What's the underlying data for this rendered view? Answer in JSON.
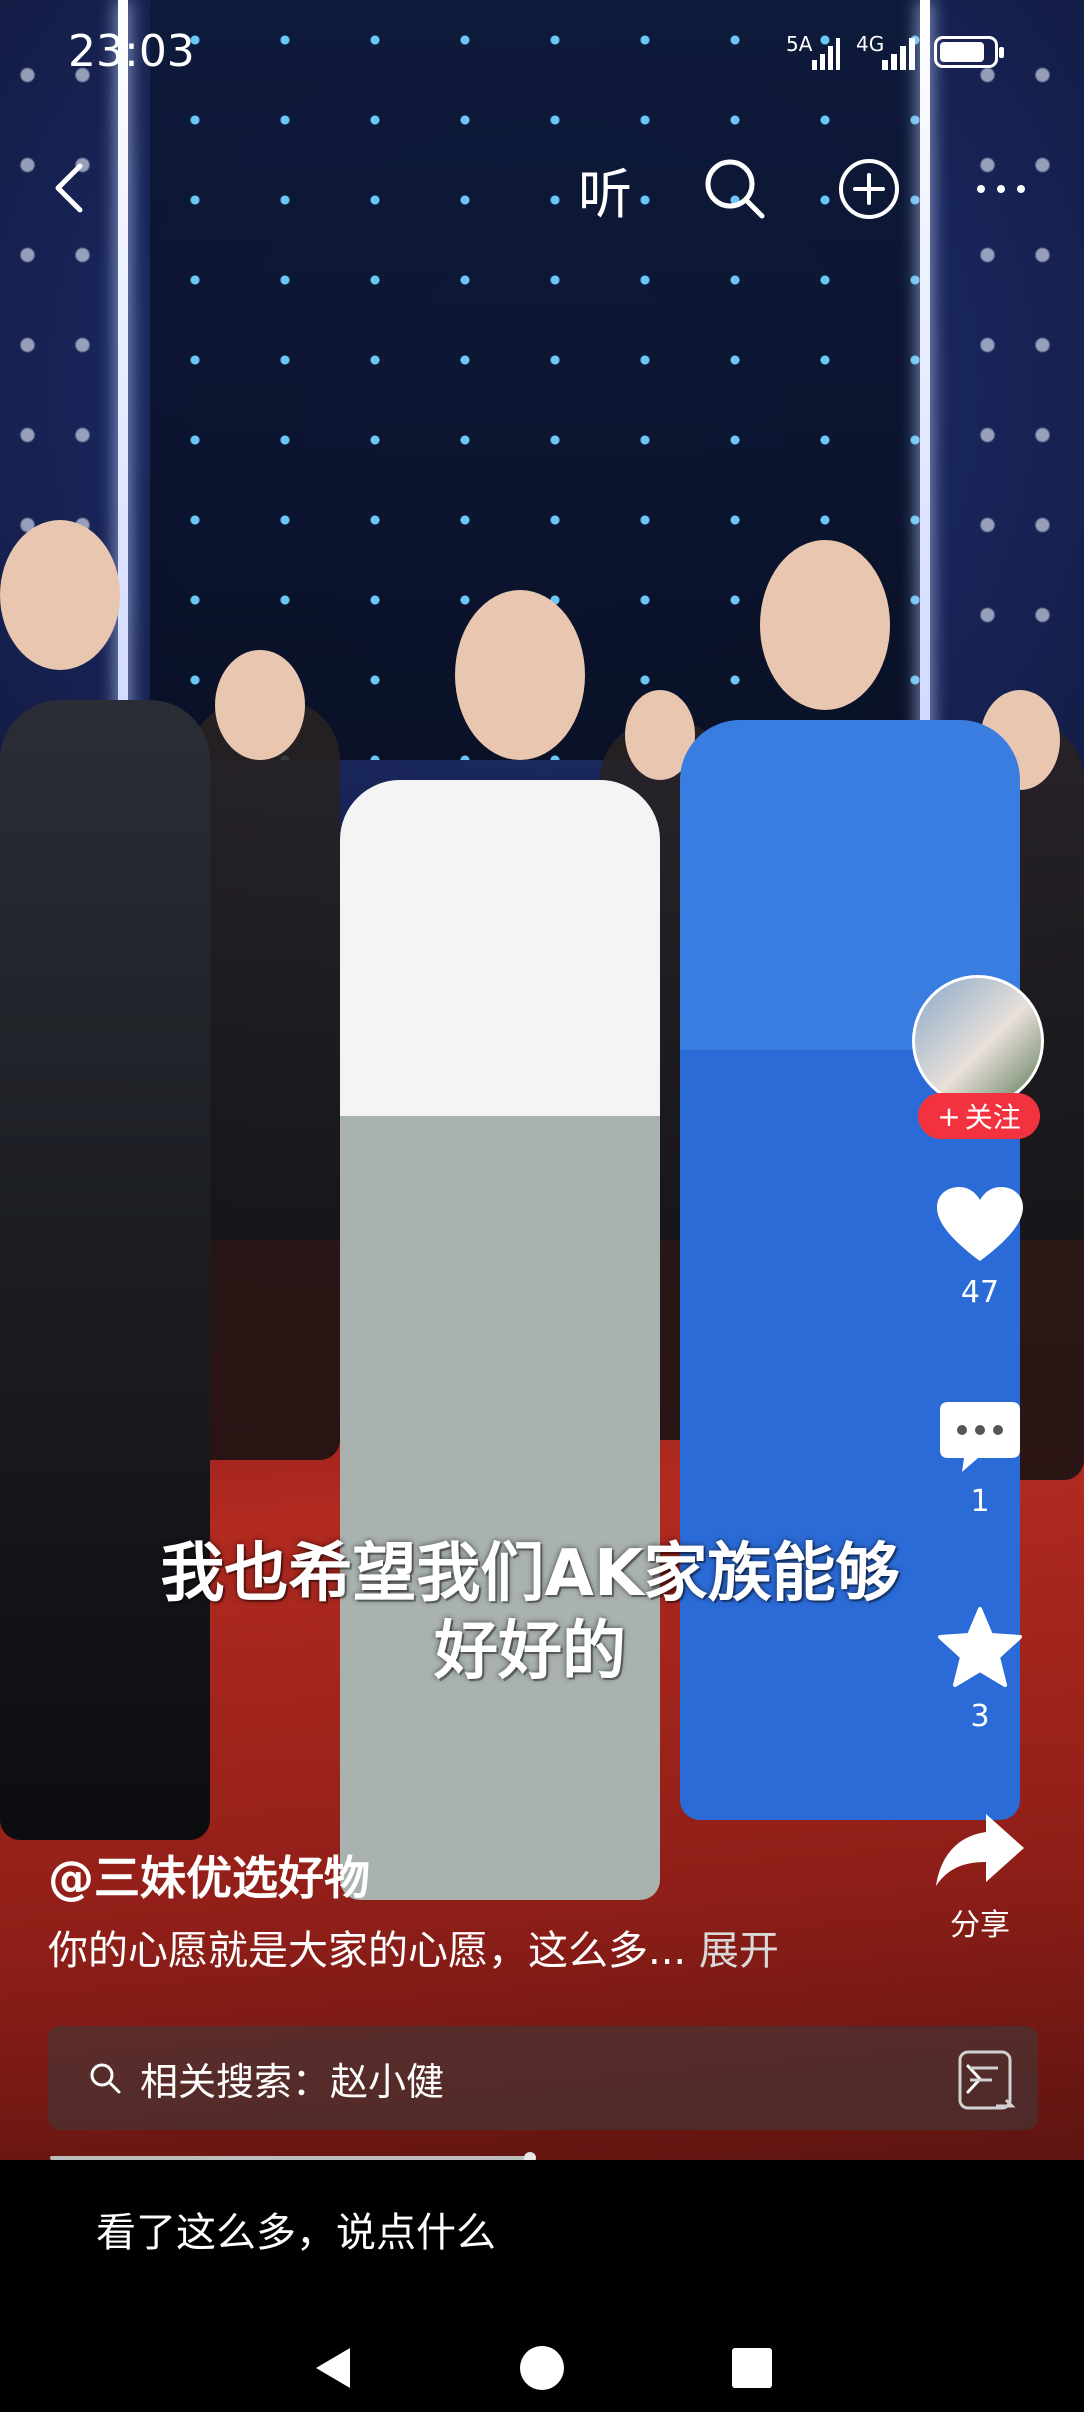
{
  "status_bar": {
    "time": "23:03",
    "signal_1": "5A",
    "signal_2": "4G"
  },
  "top_nav": {
    "back_icon": "chevron-left-icon",
    "listen_label": "听",
    "search_icon": "search-icon",
    "add_icon": "plus-circle-icon",
    "more_icon": "more-icon"
  },
  "right_rail": {
    "follow_label": "关注",
    "like_count": "47",
    "comment_count": "1",
    "favorite_count": "3",
    "share_label": "分享"
  },
  "video": {
    "subtitle_line1": "我也希望我们AK家族能够",
    "subtitle_line2": "好好的"
  },
  "post": {
    "author": "@三妹优选好物",
    "description": "你的心愿就是大家的心愿，这么多...",
    "expand_label": "展开"
  },
  "related_search": {
    "label": "相关搜索：赵小健"
  },
  "comment_bar": {
    "placeholder": "看了这么多，说点什么"
  },
  "colors": {
    "follow_red": "#f2333f",
    "background": "#000000"
  }
}
